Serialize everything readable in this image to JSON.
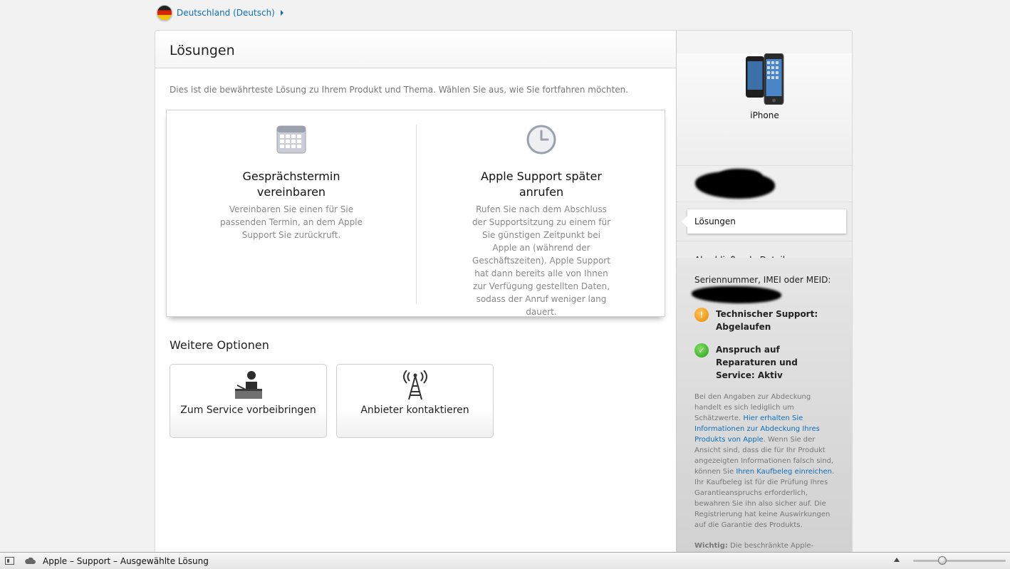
{
  "locale": {
    "label": "Deutschland (Deutsch)"
  },
  "main": {
    "title": "Lösungen",
    "intro": "Dies ist die bewährteste Lösung zu Ihrem Produkt und Thema. Wählen Sie aus, wie Sie fortfahren möchten.",
    "solutions": [
      {
        "icon": "calendar-icon",
        "title": "Gesprächstermin vereinbaren",
        "desc": "Vereinbaren Sie einen für Sie passenden Termin, an dem Apple Support Sie zurückruft."
      },
      {
        "icon": "clock-icon",
        "title": "Apple Support später anrufen",
        "desc": "Rufen Sie nach dem Abschluss der Supportsitzung zu einem für Sie günstigen Zeitpunkt bei Apple an (während der Geschäftszeiten). Apple Support hat dann bereits alle von Ihnen zur Verfügung gestellten Daten, sodass der Anruf weniger lang dauert."
      }
    ],
    "more_title": "Weitere Optionen",
    "options": [
      {
        "icon": "service-desk-icon",
        "label": "Zum Service vorbeibringen"
      },
      {
        "icon": "antenna-tower-icon",
        "label": "Anbieter kontaktieren"
      }
    ]
  },
  "sidebar": {
    "product_name": "iPhone",
    "nav_active": "Lösungen",
    "nav_next": "Abschließende Details",
    "serial_label": "Seriennummer, IMEI oder MEID:",
    "status": [
      {
        "icon": "warning-icon",
        "glyph": "!",
        "text": "Technischer Support: Abgelaufen"
      },
      {
        "icon": "checkmark-icon",
        "glyph": "✓",
        "text": "Anspruch auf Reparaturen und Service: Aktiv"
      }
    ],
    "note": {
      "p1": "Bei den Angaben zur Abdeckung handelt es sich lediglich um Schätzwerte.",
      "link1": "Hier erhalten Sie Informationen zur Abdeckung Ihres Produkts von Apple",
      "p2": "Wenn Sie der Ansicht sind, dass die für Ihr Produkt angezeigten Informationen falsch sind, können Sie",
      "link2": "Ihren Kaufbeleg einreichen",
      "p3": "Ihr Kaufbeleg ist für die Prüfung Ihres Garantieanspruchs erforderlich, bewahren Sie ihn also sicher auf. Die Registrierung hat keine Auswirkungen auf die Garantie des Produkts.",
      "strong": "Wichtig:",
      "p4": "Die beschränkte Apple-Garantie über ein Jahr und die Vorteile"
    }
  },
  "statusbar": {
    "title": "Apple – Support – Ausgewählte Lösung"
  },
  "colors": {
    "link": "#0f6fb8",
    "warning": "#e98a00",
    "ok": "#2f9e1e"
  }
}
